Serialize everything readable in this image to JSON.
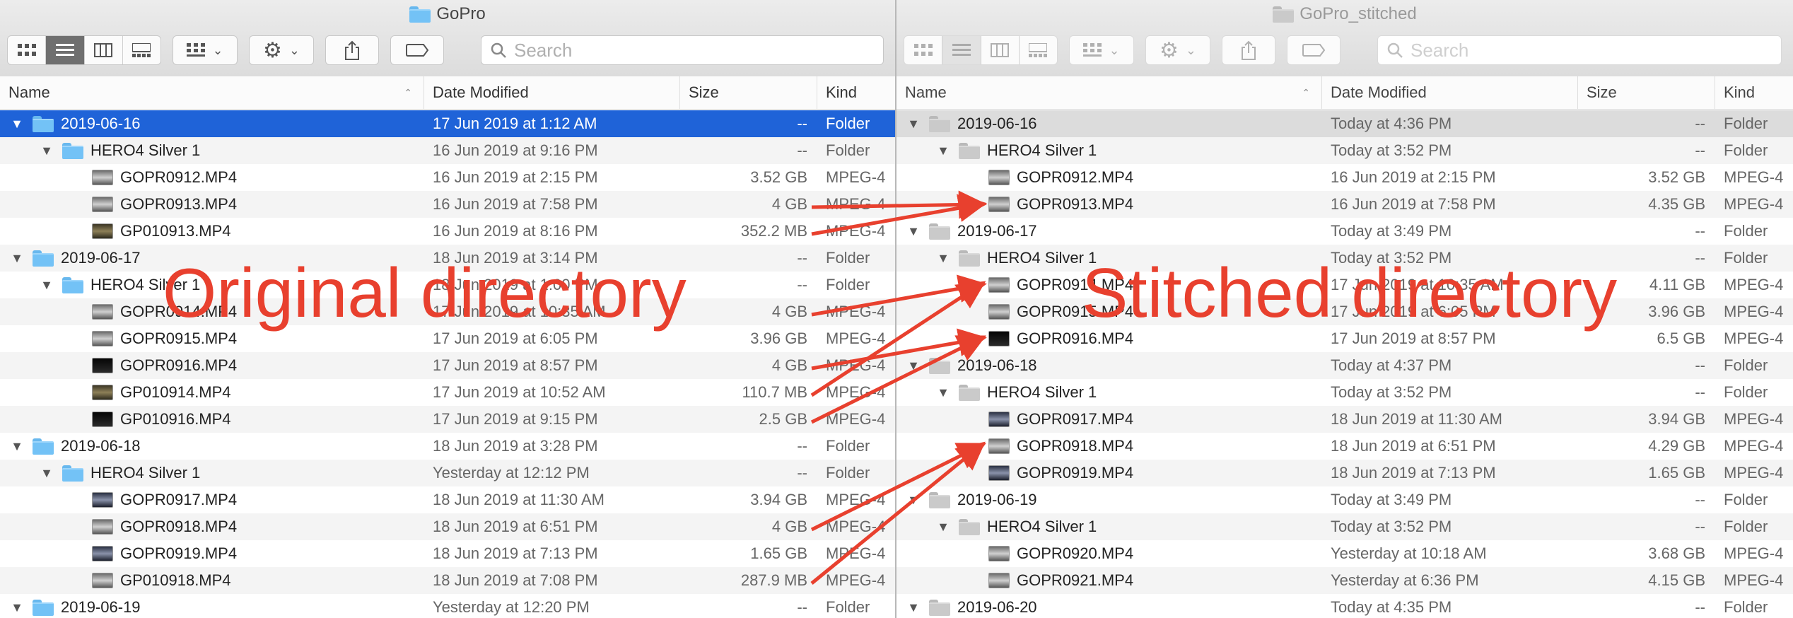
{
  "left_window": {
    "title": "GoPro",
    "search_placeholder": "Search",
    "columns": {
      "name": "Name",
      "date": "Date Modified",
      "size": "Size",
      "kind": "Kind"
    },
    "rows": [
      {
        "level": 0,
        "type": "folder",
        "name": "2019-06-16",
        "date": "17 Jun 2019 at 1:12 AM",
        "size": "--",
        "kind": "Folder",
        "selected": true
      },
      {
        "level": 1,
        "type": "folder",
        "name": "HERO4 Silver 1",
        "date": "16 Jun 2019 at 9:16 PM",
        "size": "--",
        "kind": "Folder"
      },
      {
        "level": 2,
        "type": "file",
        "thumb": "light",
        "name": "GOPR0912.MP4",
        "date": "16 Jun 2019 at 2:15 PM",
        "size": "3.52 GB",
        "kind": "MPEG-4"
      },
      {
        "level": 2,
        "type": "file",
        "thumb": "light",
        "name": "GOPR0913.MP4",
        "date": "16 Jun 2019 at 7:58 PM",
        "size": "4 GB",
        "kind": "MPEG-4"
      },
      {
        "level": 2,
        "type": "file",
        "thumb": "warm",
        "name": "GP010913.MP4",
        "date": "16 Jun 2019 at 8:16 PM",
        "size": "352.2 MB",
        "kind": "MPEG-4"
      },
      {
        "level": 0,
        "type": "folder",
        "name": "2019-06-17",
        "date": "18 Jun 2019 at 3:14 PM",
        "size": "--",
        "kind": "Folder"
      },
      {
        "level": 1,
        "type": "folder",
        "name": "HERO4 Silver 1",
        "date": "18 Jun 2019 at 1:00 PM",
        "size": "--",
        "kind": "Folder"
      },
      {
        "level": 2,
        "type": "file",
        "thumb": "light",
        "name": "GOPR0914.MP4",
        "date": "17 Jun 2019 at 10:35 AM",
        "size": "4 GB",
        "kind": "MPEG-4"
      },
      {
        "level": 2,
        "type": "file",
        "thumb": "light",
        "name": "GOPR0915.MP4",
        "date": "17 Jun 2019 at 6:05 PM",
        "size": "3.96 GB",
        "kind": "MPEG-4"
      },
      {
        "level": 2,
        "type": "file",
        "thumb": "dark",
        "name": "GOPR0916.MP4",
        "date": "17 Jun 2019 at 8:57 PM",
        "size": "4 GB",
        "kind": "MPEG-4"
      },
      {
        "level": 2,
        "type": "file",
        "thumb": "warm",
        "name": "GP010914.MP4",
        "date": "17 Jun 2019 at 10:52 AM",
        "size": "110.7 MB",
        "kind": "MPEG-4"
      },
      {
        "level": 2,
        "type": "file",
        "thumb": "dark",
        "name": "GP010916.MP4",
        "date": "17 Jun 2019 at 9:15 PM",
        "size": "2.5 GB",
        "kind": "MPEG-4"
      },
      {
        "level": 0,
        "type": "folder",
        "name": "2019-06-18",
        "date": "18 Jun 2019 at 3:28 PM",
        "size": "--",
        "kind": "Folder"
      },
      {
        "level": 1,
        "type": "folder",
        "name": "HERO4 Silver 1",
        "date": "Yesterday at 12:12 PM",
        "size": "--",
        "kind": "Folder"
      },
      {
        "level": 2,
        "type": "file",
        "thumb": "blue",
        "name": "GOPR0917.MP4",
        "date": "18 Jun 2019 at 11:30 AM",
        "size": "3.94 GB",
        "kind": "MPEG-4"
      },
      {
        "level": 2,
        "type": "file",
        "thumb": "light",
        "name": "GOPR0918.MP4",
        "date": "18 Jun 2019 at 6:51 PM",
        "size": "4 GB",
        "kind": "MPEG-4"
      },
      {
        "level": 2,
        "type": "file",
        "thumb": "blue",
        "name": "GOPR0919.MP4",
        "date": "18 Jun 2019 at 7:13 PM",
        "size": "1.65 GB",
        "kind": "MPEG-4"
      },
      {
        "level": 2,
        "type": "file",
        "thumb": "light",
        "name": "GP010918.MP4",
        "date": "18 Jun 2019 at 7:08 PM",
        "size": "287.9 MB",
        "kind": "MPEG-4"
      },
      {
        "level": 0,
        "type": "folder",
        "name": "2019-06-19",
        "date": "Yesterday at 12:20 PM",
        "size": "--",
        "kind": "Folder"
      }
    ]
  },
  "right_window": {
    "title": "GoPro_stitched",
    "search_placeholder": "Search",
    "columns": {
      "name": "Name",
      "date": "Date Modified",
      "size": "Size",
      "kind": "Kind"
    },
    "rows": [
      {
        "level": 0,
        "type": "folder",
        "name": "2019-06-16",
        "date": "Today at 4:36 PM",
        "size": "--",
        "kind": "Folder",
        "selected": true
      },
      {
        "level": 1,
        "type": "folder",
        "name": "HERO4 Silver 1",
        "date": "Today at 3:52 PM",
        "size": "--",
        "kind": "Folder"
      },
      {
        "level": 2,
        "type": "file",
        "thumb": "light",
        "name": "GOPR0912.MP4",
        "date": "16 Jun 2019 at 2:15 PM",
        "size": "3.52 GB",
        "kind": "MPEG-4"
      },
      {
        "level": 2,
        "type": "file",
        "thumb": "light",
        "name": "GOPR0913.MP4",
        "date": "16 Jun 2019 at 7:58 PM",
        "size": "4.35 GB",
        "kind": "MPEG-4"
      },
      {
        "level": 0,
        "type": "folder",
        "name": "2019-06-17",
        "date": "Today at 3:49 PM",
        "size": "--",
        "kind": "Folder"
      },
      {
        "level": 1,
        "type": "folder",
        "name": "HERO4 Silver 1",
        "date": "Today at 3:52 PM",
        "size": "--",
        "kind": "Folder"
      },
      {
        "level": 2,
        "type": "file",
        "thumb": "light",
        "name": "GOPR0914.MP4",
        "date": "17 Jun 2019 at 10:35 AM",
        "size": "4.11 GB",
        "kind": "MPEG-4"
      },
      {
        "level": 2,
        "type": "file",
        "thumb": "light",
        "name": "GOPR0915.MP4",
        "date": "17 Jun 2019 at 6:05 PM",
        "size": "3.96 GB",
        "kind": "MPEG-4"
      },
      {
        "level": 2,
        "type": "file",
        "thumb": "dark",
        "name": "GOPR0916.MP4",
        "date": "17 Jun 2019 at 8:57 PM",
        "size": "6.5 GB",
        "kind": "MPEG-4"
      },
      {
        "level": 0,
        "type": "folder",
        "name": "2019-06-18",
        "date": "Today at 4:37 PM",
        "size": "--",
        "kind": "Folder"
      },
      {
        "level": 1,
        "type": "folder",
        "name": "HERO4 Silver 1",
        "date": "Today at 3:52 PM",
        "size": "--",
        "kind": "Folder"
      },
      {
        "level": 2,
        "type": "file",
        "thumb": "blue",
        "name": "GOPR0917.MP4",
        "date": "18 Jun 2019 at 11:30 AM",
        "size": "3.94 GB",
        "kind": "MPEG-4"
      },
      {
        "level": 2,
        "type": "file",
        "thumb": "light",
        "name": "GOPR0918.MP4",
        "date": "18 Jun 2019 at 6:51 PM",
        "size": "4.29 GB",
        "kind": "MPEG-4"
      },
      {
        "level": 2,
        "type": "file",
        "thumb": "blue",
        "name": "GOPR0919.MP4",
        "date": "18 Jun 2019 at 7:13 PM",
        "size": "1.65 GB",
        "kind": "MPEG-4"
      },
      {
        "level": 0,
        "type": "folder",
        "name": "2019-06-19",
        "date": "Today at 3:49 PM",
        "size": "--",
        "kind": "Folder"
      },
      {
        "level": 1,
        "type": "folder",
        "name": "HERO4 Silver 1",
        "date": "Today at 3:52 PM",
        "size": "--",
        "kind": "Folder"
      },
      {
        "level": 2,
        "type": "file",
        "thumb": "light",
        "name": "GOPR0920.MP4",
        "date": "Yesterday at 10:18 AM",
        "size": "3.68 GB",
        "kind": "MPEG-4"
      },
      {
        "level": 2,
        "type": "file",
        "thumb": "light",
        "name": "GOPR0921.MP4",
        "date": "Yesterday at 6:36 PM",
        "size": "4.15 GB",
        "kind": "MPEG-4"
      },
      {
        "level": 0,
        "type": "folder",
        "name": "2019-06-20",
        "date": "Today at 4:35 PM",
        "size": "--",
        "kind": "Folder"
      }
    ]
  },
  "annotations": {
    "left_label": "Original directory",
    "right_label": "Stitched directory",
    "color": "#e8402e",
    "arrows": [
      {
        "from_left_row": 3,
        "to_right_row": 3
      },
      {
        "from_left_row": 4,
        "to_right_row": 3
      },
      {
        "from_left_row": 7,
        "to_right_row": 6
      },
      {
        "from_left_row": 9,
        "to_right_row": 8
      },
      {
        "from_left_row": 10,
        "to_right_row": 6
      },
      {
        "from_left_row": 11,
        "to_right_row": 8
      },
      {
        "from_left_row": 15,
        "to_right_row": 12
      },
      {
        "from_left_row": 17,
        "to_right_row": 12
      }
    ]
  },
  "colors": {
    "selection_active": "#1f63d8",
    "selection_inactive": "#dcdcdc",
    "folder_blue": "#73c2f6"
  }
}
